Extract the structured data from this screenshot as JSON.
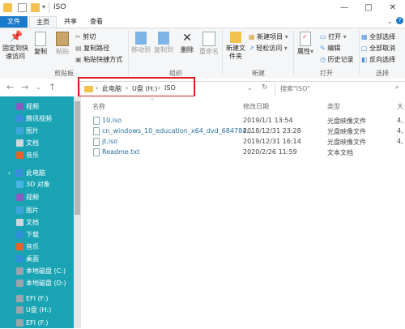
{
  "window": {
    "title": "ISO",
    "controls": [
      "—",
      "□",
      "✕"
    ]
  },
  "tabs": {
    "file": "文件",
    "home": "主页",
    "share": "共享",
    "view": "查看"
  },
  "ribbon": {
    "pin_label": "固定到快速访问",
    "copy_label": "复制",
    "paste_label": "粘贴",
    "cut": "剪切",
    "copy_path": "复制路径",
    "paste_shortcut": "粘贴快捷方式",
    "clipboard_group": "剪贴板",
    "move_to": "移动到",
    "copy_to": "复制到",
    "delete": "删除",
    "rename": "重命名",
    "organize_group": "组织",
    "new_folder": "新建文件夹",
    "new_item": "新建项目",
    "easy_access": "轻松访问",
    "new_group": "新建",
    "properties": "属性",
    "open": "打开",
    "edit": "编辑",
    "history": "历史记录",
    "open_group": "打开",
    "select_all": "全部选择",
    "select_none": "全部取消",
    "invert": "反向选择",
    "select_group": "选择"
  },
  "address": {
    "segments": [
      "此电脑",
      "U盘 (H:)",
      "ISO"
    ],
    "search_placeholder": "搜索\"ISO\""
  },
  "sidebar": {
    "items": [
      {
        "label": "视频",
        "color": "#8a5cc2"
      },
      {
        "label": "腾讯视频",
        "color": "#3c8dde"
      },
      {
        "label": "图片",
        "color": "#3fa6dd"
      },
      {
        "label": "文档",
        "color": "#d0d6dd"
      },
      {
        "label": "音乐",
        "color": "#e8632a"
      },
      {
        "label": "此电脑",
        "color": "#3c8dde"
      },
      {
        "label": "3D 对象",
        "color": "#4ab4e6"
      },
      {
        "label": "视频",
        "color": "#8a5cc2"
      },
      {
        "label": "图片",
        "color": "#3fa6dd"
      },
      {
        "label": "文档",
        "color": "#d0d6dd"
      },
      {
        "label": "下载",
        "color": "#2f8fd8"
      },
      {
        "label": "音乐",
        "color": "#e8632a"
      },
      {
        "label": "桌面",
        "color": "#2f8fd8"
      },
      {
        "label": "本地磁盘 (C:)",
        "color": "#9aa5ad"
      },
      {
        "label": "本地磁盘 (D:)",
        "color": "#9aa5ad"
      },
      {
        "label": "EFI (F:)",
        "color": "#9aa5ad"
      },
      {
        "label": "U盘 (H:)",
        "color": "#9aa5ad"
      },
      {
        "label": "EFI (F:)",
        "color": "#9aa5ad"
      }
    ]
  },
  "columns": {
    "name": "名称",
    "date": "修改日期",
    "type": "类型",
    "size": "大"
  },
  "files": [
    {
      "name": "10.iso",
      "date": "2019/1/1 13:54",
      "type": "光盘映像文件",
      "size": "4,"
    },
    {
      "name": "cn_windows_10_education_x64_dvd_684784...",
      "date": "2018/12/31 23:28",
      "type": "光盘映像文件",
      "size": "4,"
    },
    {
      "name": "jt.iso",
      "date": "2019/12/31 16:14",
      "type": "光盘映像文件",
      "size": "4,"
    },
    {
      "name": "Readme.txt",
      "date": "2020/2/26 11:59",
      "type": "文本文档",
      "size": ""
    }
  ],
  "colors": {
    "accent": "#1979ca",
    "sidebar": "#1aa3b3",
    "highlight": "#e02020"
  }
}
